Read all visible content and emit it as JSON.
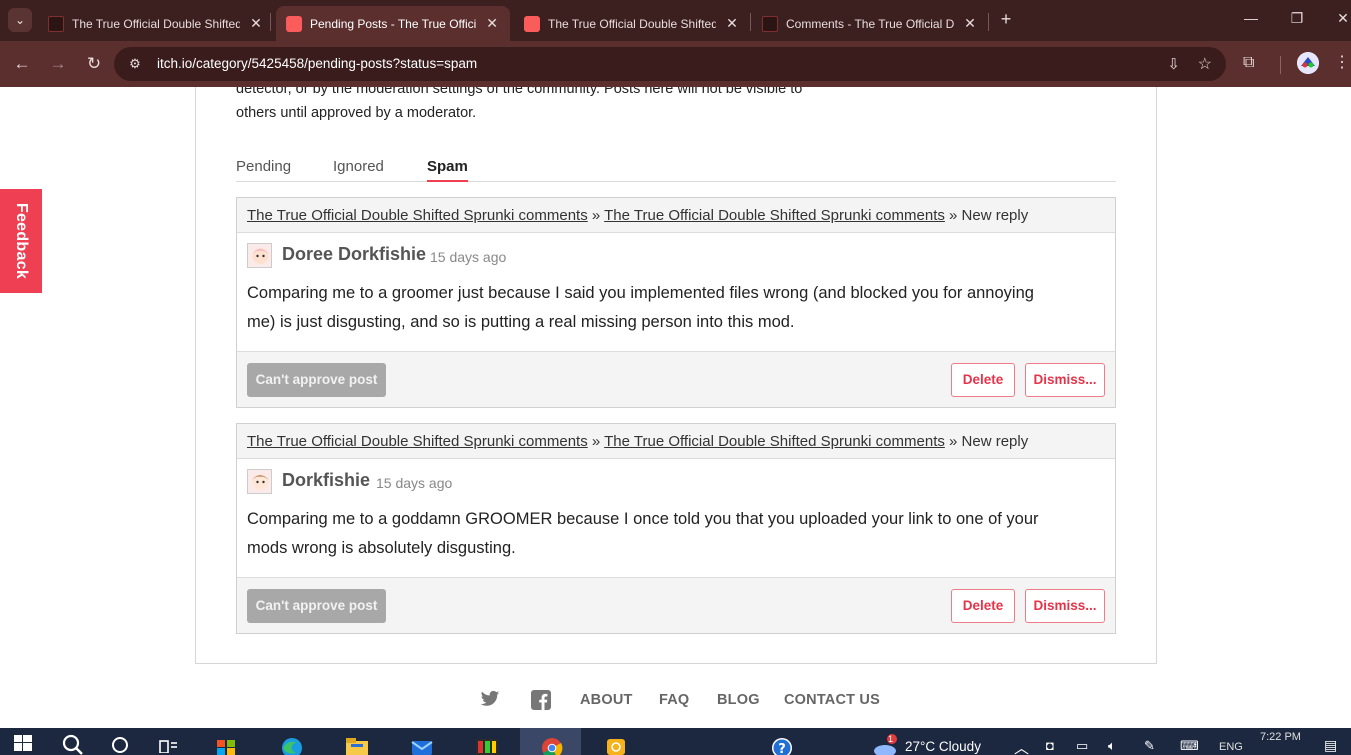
{
  "browser": {
    "tabs": [
      {
        "title": "The True Official Double Shifted",
        "active": false
      },
      {
        "title": "Pending Posts - The True Official",
        "active": true
      },
      {
        "title": "The True Official Double Shifted",
        "active": false
      },
      {
        "title": "Comments - The True Official D",
        "active": false
      }
    ],
    "url": "itch.io/category/5425458/pending-posts?status=spam"
  },
  "page": {
    "feedback_label": "Feedback",
    "description": "detector, or by the moderation settings of the community. Posts here will not be visible to others until approved by a moderator.",
    "filter_tabs": [
      {
        "label": "Pending",
        "active": false
      },
      {
        "label": "Ignored",
        "active": false
      },
      {
        "label": "Spam",
        "active": true
      }
    ],
    "posts": [
      {
        "crumb_1": "The True Official Double Shifted Sprunki comments",
        "crumb_sep": "»",
        "crumb_2": "The True Official Double Shifted Sprunki comments",
        "crumb_3": "» New reply",
        "author": "Doree Dorkfishie",
        "date": "15 days ago",
        "text": "Comparing me to a groomer just because I said you implemented files wrong (and blocked you for annoying me) is just disgusting, and so is putting a real missing person into this mod.",
        "approve_label": "Can't approve post",
        "delete_label": "Delete",
        "dismiss_label": "Dismiss..."
      },
      {
        "crumb_1": "The True Official Double Shifted Sprunki comments",
        "crumb_sep": "»",
        "crumb_2": "The True Official Double Shifted Sprunki comments",
        "crumb_3": "» New reply",
        "author": "Dorkfishie",
        "date": "15 days ago",
        "text": "Comparing me to a goddamn GROOMER because I once told you that you uploaded your link to one of your mods wrong is absolutely disgusting.",
        "approve_label": "Can't approve post",
        "delete_label": "Delete",
        "dismiss_label": "Dismiss..."
      }
    ],
    "footer": {
      "links": [
        "ABOUT",
        "FAQ",
        "BLOG",
        "CONTACT US"
      ]
    }
  },
  "taskbar": {
    "weather_badge": "1",
    "weather": "27°C  Cloudy",
    "lang": "ENG",
    "time": "7:22 PM"
  },
  "colors": {
    "accent": "#ee3f53",
    "chrome_dark": "#3c1f1f",
    "chrome_toolbar": "#5c2f2f",
    "taskbar": "#1c2740"
  }
}
